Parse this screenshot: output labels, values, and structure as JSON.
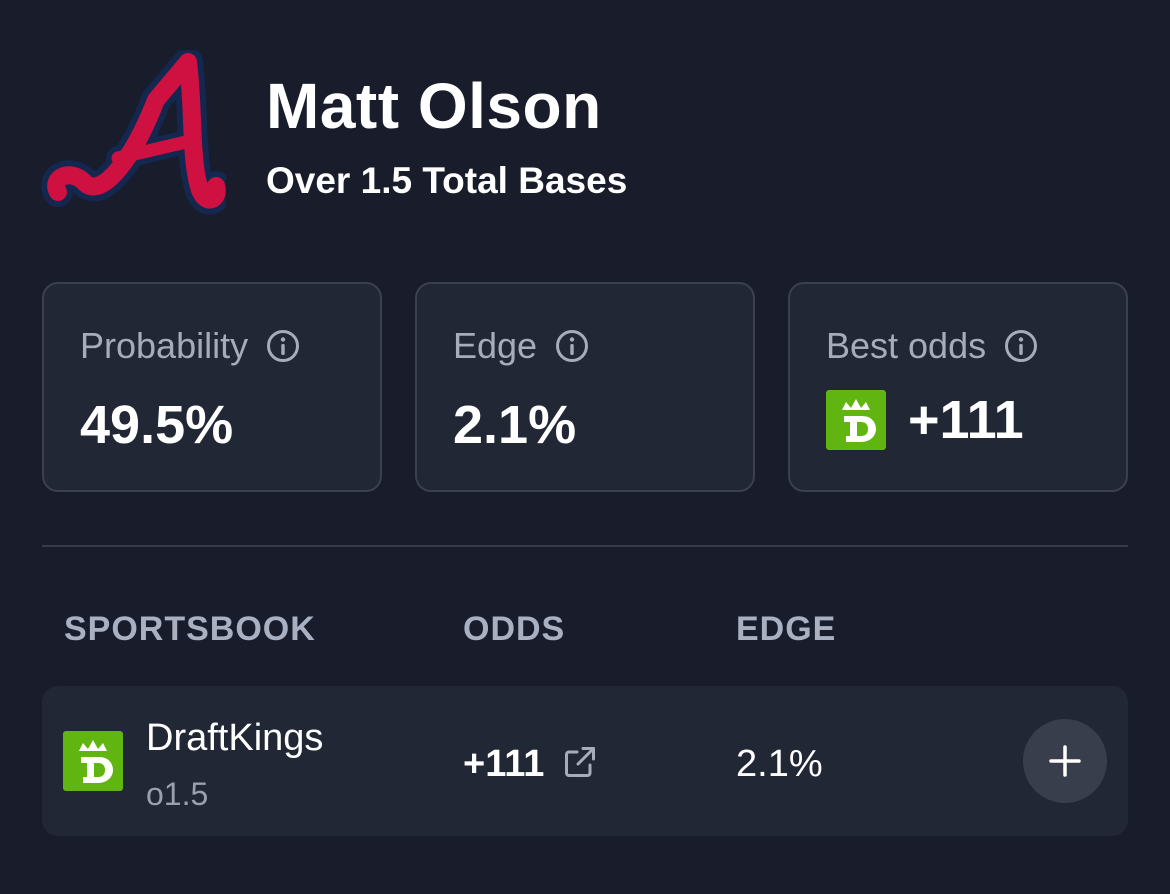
{
  "header": {
    "team_logo_icon": "braves-a-logo",
    "player_name": "Matt Olson",
    "bet_line": "Over 1.5 Total Bases"
  },
  "stats": {
    "probability": {
      "label": "Probability",
      "value": "49.5%",
      "icon": "info-icon"
    },
    "edge": {
      "label": "Edge",
      "value": "2.1%",
      "icon": "info-icon"
    },
    "best_odds": {
      "label": "Best odds",
      "value": "+111",
      "book_icon": "draftkings-logo",
      "icon": "info-icon"
    }
  },
  "table": {
    "headers": {
      "sportsbook": "SPORTSBOOK",
      "odds": "ODDS",
      "edge": "EDGE"
    },
    "rows": [
      {
        "book": "DraftKings",
        "line": "o1.5",
        "odds": "+111",
        "edge": "2.1%",
        "book_icon": "draftkings-logo",
        "link_icon": "external-link-icon",
        "action_icon": "plus-icon"
      }
    ]
  },
  "colors": {
    "background": "#181c2b",
    "card": "#222736",
    "card_border": "#3a4050",
    "muted_text": "#a6acba",
    "draftkings_green": "#61b510",
    "braves_red": "#ce1141",
    "braves_navy": "#13274f"
  }
}
